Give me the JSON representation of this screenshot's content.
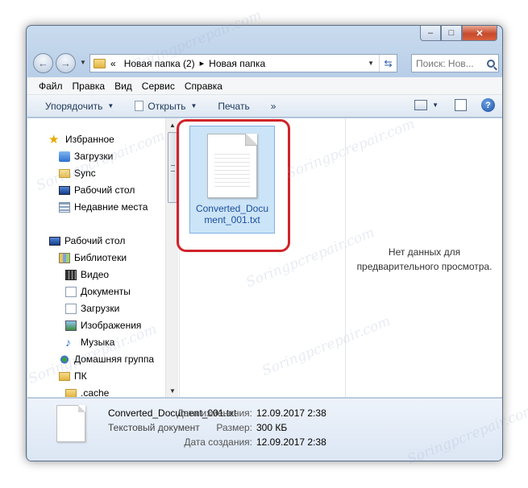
{
  "window": {
    "controls": {
      "minimize": "–",
      "maximize": "□",
      "close": "✕"
    }
  },
  "nav": {
    "back_arrow": "←",
    "forward_arrow": "→",
    "breadcrumb": [
      "Новая папка (2)",
      "Новая папка"
    ],
    "breadcrumb_prefix": "«",
    "separator": "▸",
    "search_placeholder": "Поиск: Нов..."
  },
  "menu": {
    "items": [
      "Файл",
      "Правка",
      "Вид",
      "Сервис",
      "Справка"
    ]
  },
  "toolbar": {
    "organize": "Упорядочить",
    "open": "Открыть",
    "print": "Печать",
    "more": "»",
    "help": "?"
  },
  "sidebar": {
    "items": [
      {
        "label": "Избранное",
        "icon": "star-icon"
      },
      {
        "label": "Загрузки",
        "icon": "downloads-icon"
      },
      {
        "label": "Sync",
        "icon": "folder-icon"
      },
      {
        "label": "Рабочий стол",
        "icon": "desktop-icon"
      },
      {
        "label": "Недавние места",
        "icon": "recent-places-icon"
      },
      {
        "label": "Рабочий стол",
        "icon": "desktop-icon"
      },
      {
        "label": "Библиотеки",
        "icon": "libraries-icon"
      },
      {
        "label": "Видео",
        "icon": "video-icon"
      },
      {
        "label": "Документы",
        "icon": "documents-icon"
      },
      {
        "label": "Загрузки",
        "icon": "downloads-icon"
      },
      {
        "label": "Изображения",
        "icon": "pictures-icon"
      },
      {
        "label": "Музыка",
        "icon": "music-icon"
      },
      {
        "label": "Домашняя группа",
        "icon": "homegroup-icon"
      },
      {
        "label": "ПК",
        "icon": "computer-icon"
      },
      {
        "label": ".cache",
        "icon": "folder-icon"
      }
    ]
  },
  "files": [
    {
      "name": "Converted_Document_001.txt",
      "display_lines": [
        "Converted_Docu",
        "ment_001.txt"
      ],
      "icon": "text-file-icon"
    }
  ],
  "preview": {
    "line1": "Нет данных для",
    "line2": "предварительного просмотра."
  },
  "details": {
    "name": "Converted_Document_001.txt",
    "type": "Текстовый документ",
    "modified_label": "Дата изменения:",
    "modified_value": "12.09.2017 2:38",
    "size_label": "Размер:",
    "size_value": "300 КБ",
    "created_label": "Дата создания:",
    "created_value": "12.09.2017 2:38"
  },
  "watermark_text": "Soringpcrepair.com",
  "colors": {
    "highlight": "#d2232a",
    "selection": "#cce4f7",
    "link": "#1a4fa0"
  }
}
